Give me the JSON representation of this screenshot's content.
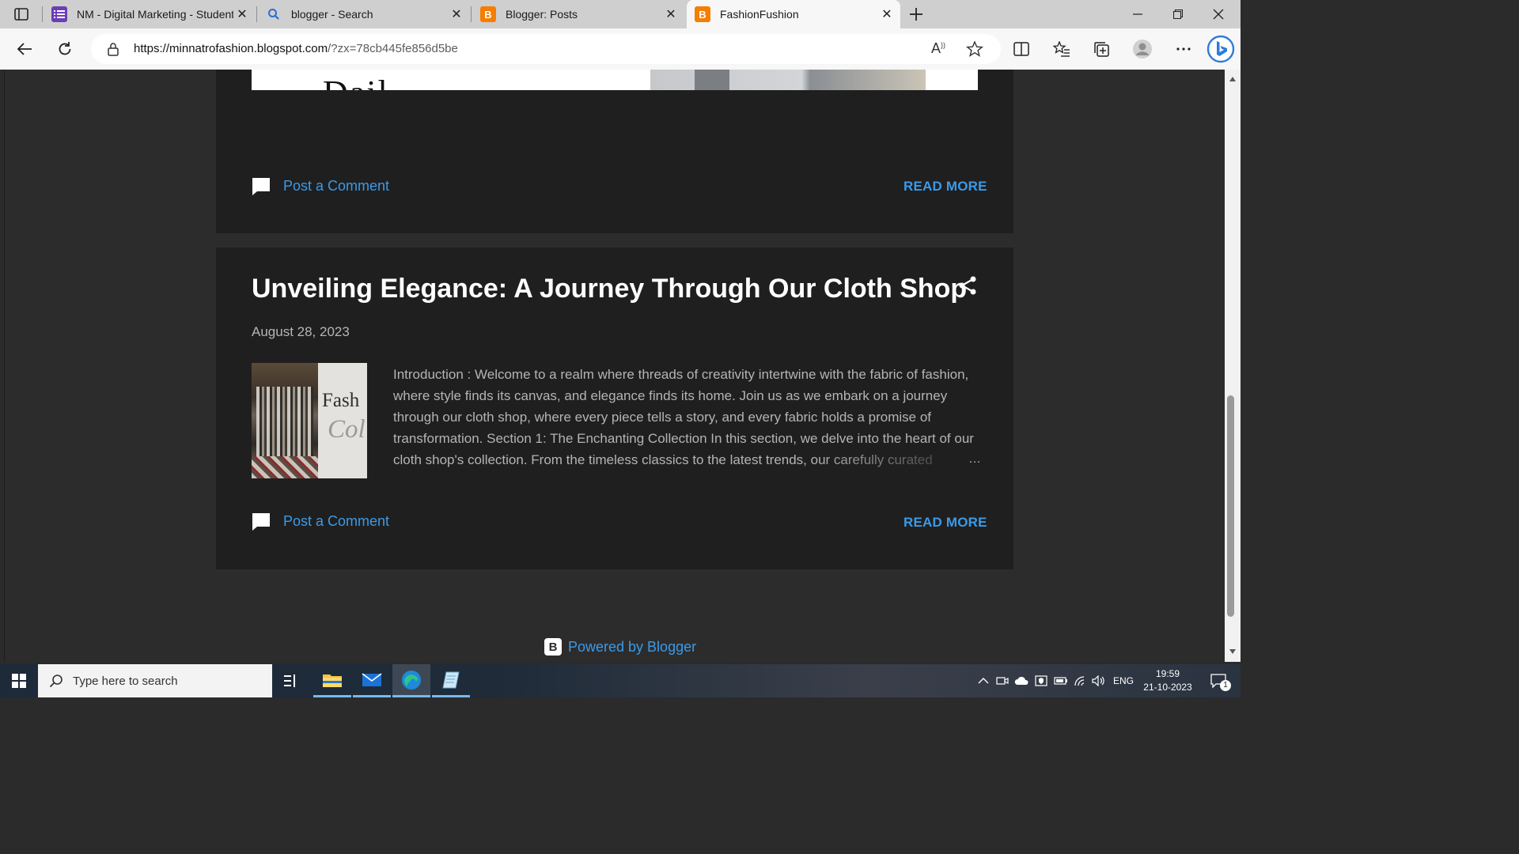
{
  "browser": {
    "tabs": [
      {
        "title": "NM - Digital Marketing - Student",
        "icon": "forms-icon",
        "active": false
      },
      {
        "title": "blogger - Search",
        "icon": "search-icon",
        "active": false
      },
      {
        "title": "Blogger: Posts",
        "icon": "blogger-icon",
        "active": false
      },
      {
        "title": "FashionFushion",
        "icon": "blogger-icon",
        "active": true
      }
    ],
    "url_host": "https://minnatrofashion.blogspot.com",
    "url_rest": "/?zx=78cb445fe856d5be",
    "read_aloud_label": "A",
    "colors": {
      "tab_bar": "#cfcfcf",
      "active_tab": "#f7f7f7",
      "accent": "#3b9ae8"
    }
  },
  "page": {
    "previous_post": {
      "image_text": "Dail",
      "comment_label": "Post a Comment",
      "read_more_label": "READ MORE"
    },
    "post": {
      "title": "Unveiling Elegance: A Journey Through Our Cloth Shop",
      "date": "August 28, 2023",
      "thumbnail_text_1": "Fash",
      "thumbnail_text_2": "Col",
      "snippet": "Introduction : Welcome to a realm where threads of creativity intertwine with the fabric of fashion, where style finds its canvas, and elegance finds its home. Join us as we embark on a journey through our cloth shop, where every piece tells a story, and every fabric holds a promise of transformation. Section 1: The Enchanting Collection In this section, we delve into the heart of our cloth shop's collection. From the timeless classics to the latest trends, our carefully curated",
      "ellipsis": "…",
      "comment_label": "Post a Comment",
      "read_more_label": "READ MORE"
    },
    "footer": {
      "powered_by": "Powered by Blogger",
      "blogger_letter": "B"
    },
    "colors": {
      "card_bg": "#1f1f1f",
      "page_bg": "#2c2c2c",
      "link": "#3b9ae8"
    }
  },
  "taskbar": {
    "search_placeholder": "Type here to search",
    "language": "ENG",
    "time": "19:59",
    "date": "21-10-2023",
    "notification_count": "1"
  }
}
